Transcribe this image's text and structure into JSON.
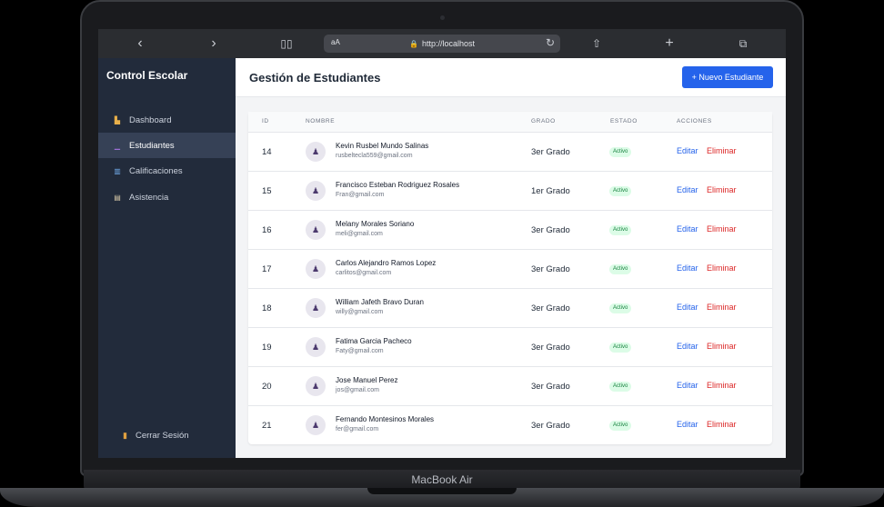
{
  "device": {
    "label": "MacBook Air"
  },
  "browser": {
    "text_size_label": "aA",
    "url": "http://localhost"
  },
  "sidebar": {
    "title": "Control Escolar",
    "items": [
      {
        "label": "Dashboard",
        "icon": "school-icon"
      },
      {
        "label": "Estudiantes",
        "icon": "students-icon",
        "active": true
      },
      {
        "label": "Calificaciones",
        "icon": "chart-icon"
      },
      {
        "label": "Asistencia",
        "icon": "clipboard-icon"
      }
    ],
    "logout_label": "Cerrar Sesión"
  },
  "header": {
    "title": "Gestión de Estudiantes",
    "new_button_label": "+ Nuevo Estudiante"
  },
  "table": {
    "columns": [
      "ID",
      "NOMBRE",
      "GRADO",
      "ESTADO",
      "ACCIONES"
    ],
    "edit_label": "Editar",
    "delete_label": "Eliminar",
    "rows": [
      {
        "id": "14",
        "name": "Kevin Rusbel Mundo Salinas",
        "email": "rusbeltecla559@gmail.com",
        "grade": "3er Grado",
        "status": "Activo"
      },
      {
        "id": "15",
        "name": "Francisco Esteban Rodriguez Rosales",
        "email": "Fran@gmail.com",
        "grade": "1er Grado",
        "status": "Activo"
      },
      {
        "id": "16",
        "name": "Melany Morales Soriano",
        "email": "meli@gmail.com",
        "grade": "3er Grado",
        "status": "Activo"
      },
      {
        "id": "17",
        "name": "Carlos Alejandro Ramos Lopez",
        "email": "carlitos@gmail.com",
        "grade": "3er Grado",
        "status": "Activo"
      },
      {
        "id": "18",
        "name": "William Jafeth Bravo Duran",
        "email": "willy@gmail.com",
        "grade": "3er Grado",
        "status": "Activo"
      },
      {
        "id": "19",
        "name": "Fatima Garcia Pacheco",
        "email": "Faty@gmail.com",
        "grade": "3er Grado",
        "status": "Activo"
      },
      {
        "id": "20",
        "name": "Jose Manuel Perez",
        "email": "jos@gmail.com",
        "grade": "3er Grado",
        "status": "Activo"
      },
      {
        "id": "21",
        "name": "Fernando Montesinos Morales",
        "email": "fer@gmail.com",
        "grade": "3er Grado",
        "status": "Activo"
      }
    ]
  },
  "colors": {
    "accent": "#2563eb",
    "sidebar": "#222b3b",
    "danger": "#dc2626",
    "success_bg": "#dcfce7"
  }
}
